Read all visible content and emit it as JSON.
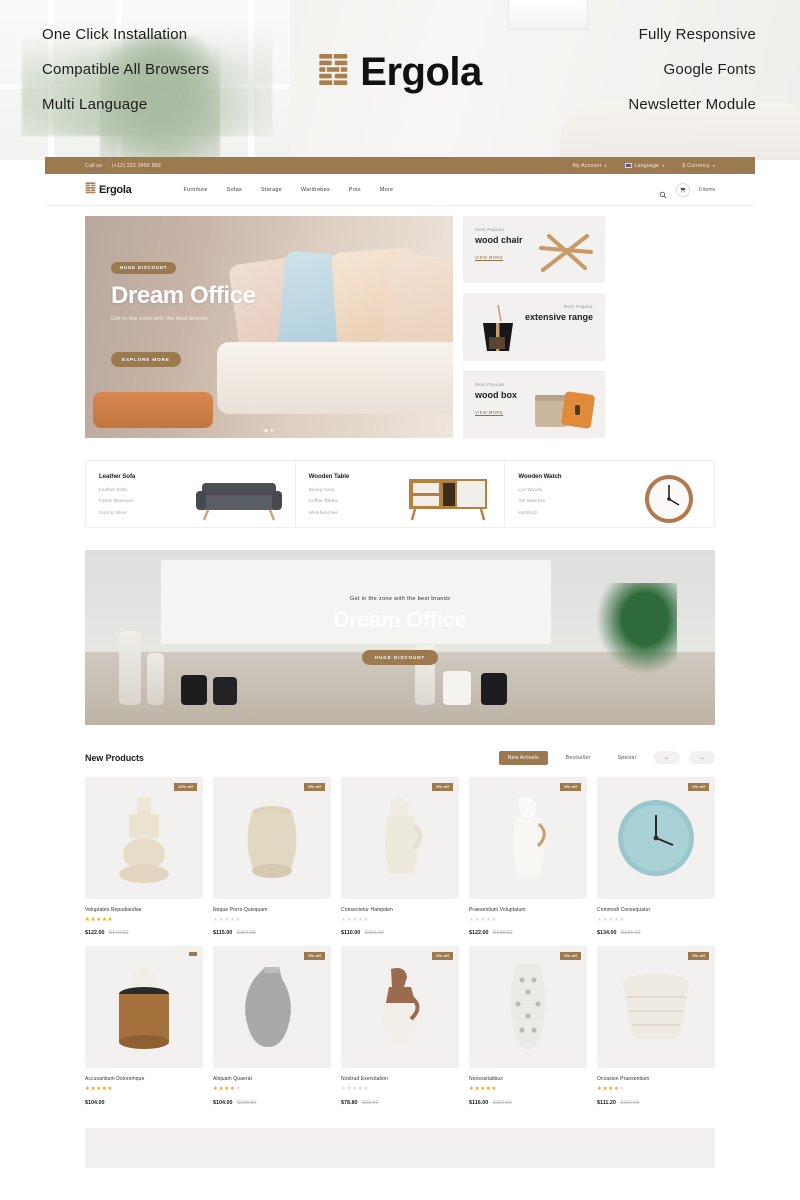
{
  "promo": {
    "left": [
      "One Click Installation",
      "Compatible All Browsers",
      "Multi Language"
    ],
    "right": [
      "Fully Responsive",
      "Google Fonts",
      "Newsletter Module"
    ],
    "brand": "Ergola",
    "logo_icon": "brick-wall-logo-icon"
  },
  "topbar": {
    "call_label": "Call us",
    "separator": ":",
    "phone": "(+12) 222 3456 888",
    "account": "My Account",
    "language": "Language",
    "currency": "$ Currency",
    "caret": "▾",
    "flag_icon": "flag-icon"
  },
  "navbar": {
    "brand": "Ergola",
    "logo_icon": "brick-wall-logo-icon",
    "links": [
      "Furniture",
      "Sofas",
      "Storage",
      "Wardrobes",
      "Pots",
      "More"
    ],
    "search_icon": "search-icon",
    "cart_icon": "shopping-cart-icon",
    "cart_text": "0 items"
  },
  "hero": {
    "badge": "HUGE DISCOUNT",
    "title": "Dream Office",
    "subtitle": "Get in the zone with the best brands",
    "button": "EXPLORE MORE",
    "slides": 2,
    "active_slide": 1
  },
  "promo_cards": [
    {
      "kicker": "Most Popular",
      "title": "wood chair",
      "link": "VIEW MORE",
      "image": "wooden-chair-image"
    },
    {
      "kicker": "Most Popular",
      "title": "extensive range",
      "link": "",
      "image": "black-dustpan-image"
    },
    {
      "kicker": "Most Popular",
      "title": "wood box",
      "link": "VIEW MORE",
      "image": "wooden-box-image"
    }
  ],
  "categories": [
    {
      "title": "Leather Sofa",
      "items": [
        "Leather belts",
        "Fabric Diamond",
        "Gold & Silver"
      ],
      "image": "grey-sofa-image"
    },
    {
      "title": "Wooden Table",
      "items": [
        "Dining room",
        "Coffee Tables",
        "Workbenches"
      ],
      "image": "wooden-sideboard-image"
    },
    {
      "title": "Wooden Watch",
      "items": [
        "Lux Woods",
        "Ovl Watches",
        "Kerbholz"
      ],
      "image": "wall-clock-image"
    }
  ],
  "wide_banner": {
    "subtitle": "Get in the zone with the best brands",
    "title": "Dream Office",
    "button": "HUGE DISCOUNT"
  },
  "new_products": {
    "heading": "New Products",
    "tabs": [
      {
        "label": "New Arrivals",
        "active": true
      },
      {
        "label": "Bestseller",
        "active": false
      },
      {
        "label": "Special",
        "active": false
      }
    ],
    "prev_icon": "arrow-left-icon",
    "next_icon": "arrow-right-icon",
    "items": [
      {
        "name": "Voluptates Repudiandae",
        "price": "$122.00",
        "old_price": "$140.00",
        "discount": "12% off",
        "rating": 5,
        "image": "beige-vase-image"
      },
      {
        "name": "Neque Porro Quisquam",
        "price": "$115.00",
        "old_price": "$118.00",
        "discount": "3% off",
        "rating": 0,
        "image": "woven-basket-jar-image"
      },
      {
        "name": "Consectetur Hampden",
        "price": "$110.00",
        "old_price": "$119.60",
        "discount": "8% off",
        "rating": 0,
        "image": "cream-pitcher-image"
      },
      {
        "name": "Praesentium Voluptatum",
        "price": "$122.00",
        "old_price": "$128.00",
        "discount": "5% off",
        "rating": 0,
        "image": "white-jug-image"
      },
      {
        "name": "Commodi Consequatur",
        "price": "$134.00",
        "old_price": "$136.40",
        "discount": "2% off",
        "rating": 0,
        "image": "teal-wall-clock-image"
      },
      {
        "name": "Accusantium Doloremque",
        "price": "$104.00",
        "old_price": "",
        "discount": "",
        "rating": 5,
        "image": "wooden-stool-image"
      },
      {
        "name": "Aliquam Quaerat",
        "price": "$104.00",
        "old_price": "$108.80",
        "discount": "5% off",
        "rating": 4,
        "image": "grey-vase-image"
      },
      {
        "name": "Nostrud Exercitation",
        "price": "$78.80",
        "old_price": "$83.60",
        "discount": "6% off",
        "rating": 0,
        "image": "brown-carafe-image"
      },
      {
        "name": "Necessitatibus",
        "price": "$116.00",
        "old_price": "$119.60",
        "discount": "3% off",
        "rating": 5,
        "image": "patterned-vase-image"
      },
      {
        "name": "Occasion Praesentium",
        "price": "$111.20",
        "old_price": "$116.00",
        "discount": "5% off",
        "rating": 4,
        "image": "wicker-basket-image"
      }
    ]
  },
  "colors": {
    "accent": "#9c7a4f",
    "star": "#f0a500",
    "panel": "#f2f1ef",
    "text": "#1d1d1d"
  }
}
